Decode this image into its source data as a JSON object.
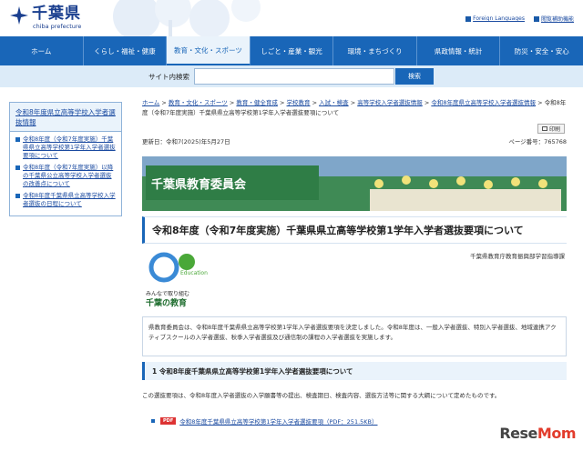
{
  "header": {
    "logo_title": "千葉県",
    "logo_sub": "chiba prefecture",
    "util_links": [
      "Foreign Languages",
      "閲覧補助機能"
    ]
  },
  "nav": {
    "items": [
      "ホーム",
      "くらし・福祉・健康",
      "教育・文化・スポーツ",
      "しごと・産業・観光",
      "環境・まちづくり",
      "県政情報・統計",
      "防災・安全・安心"
    ],
    "active_index": 2
  },
  "search": {
    "label": "サイト内検索",
    "placeholder": "",
    "button": "検索"
  },
  "sidebar": {
    "heading": "令和8年度県立高等学校入学者選抜情報",
    "items": [
      "令和8年度（令和7年度実施）千葉県県立高等学校第1学年入学者選抜要項について",
      "令和8年度（令和7年度実施）以降の千葉県公立高等学校入学者選抜の改善点について",
      "令和8年度千葉県県立高等学校入学者選抜の日程について"
    ]
  },
  "breadcrumb": {
    "links": [
      "ホーム",
      "教育・文化・スポーツ",
      "教育・健全育成",
      "学校教育",
      "入試・検査",
      "高等学校入学者選抜情報",
      "令和8年度県立高等学校入学者選抜情報"
    ],
    "separator": ">",
    "current": "令和8年度（令和7年度実施）千葉県県立高等学校第1学年入学者選抜要項について"
  },
  "print_label": "印刷",
  "meta": {
    "updated": "更新日：令和7(2025)年5月27日",
    "page_no": "ページ番号：765768"
  },
  "banner": {
    "title": "千葉県教育委員会"
  },
  "page_title": "令和8年度（令和7年度実施）千葉県県立高等学校第1学年入学者選抜要項について",
  "author": "千葉県教育庁教育振興部学習指導課",
  "edu_logo": {
    "word": "Education",
    "caption1": "みんなで取り組む",
    "caption2": "千葉の教育"
  },
  "intro": "県教育委員会は、令和8年度千葉県県立高等学校第1学年入学者選抜要項を決定しました。令和8年度は、一般入学者選抜、特別入学者選抜、地域連携アクティブスクールの入学者選抜、秋季入学者選抜及び通信制の課程の入学者選抜を実施します。",
  "section1": {
    "heading": "1 令和8年度千葉県県立高等学校第1学年入学者選抜要項について",
    "text": "この選抜要項は、令和8年度入学者選抜の入学願書等の提出、検査期日、検査内容、選抜方法等に関する大綱について定めたものです。",
    "pdf_badge": "PDF",
    "pdf_link": "令和8年度千葉県県立高等学校第1学年入学者選抜要項（PDF：251.5KB）"
  },
  "watermark": {
    "left": "Rese",
    "right": "Mom"
  },
  "colors": {
    "nav_blue": "#1966b8",
    "banner_green": "#2f7d46",
    "pdf_red": "#d33333"
  }
}
